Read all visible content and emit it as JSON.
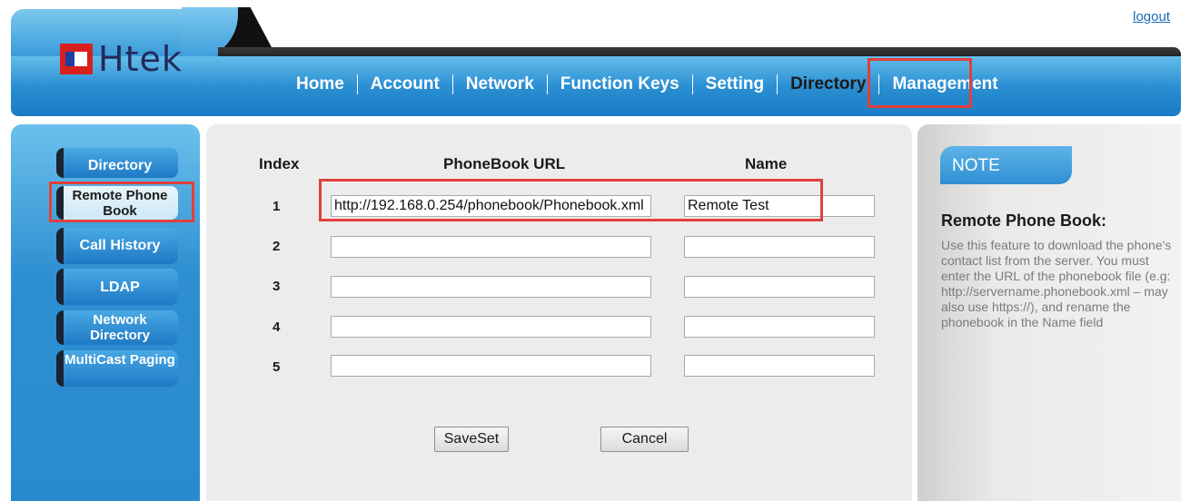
{
  "brand": {
    "logo_text": "Htek"
  },
  "header": {
    "logout_label": "logout"
  },
  "nav": {
    "items": [
      {
        "label": "Home"
      },
      {
        "label": "Account"
      },
      {
        "label": "Network"
      },
      {
        "label": "Function Keys"
      },
      {
        "label": "Setting"
      },
      {
        "label": "Directory",
        "active": true
      },
      {
        "label": "Management"
      }
    ]
  },
  "sidebar": {
    "items": [
      {
        "label": "Directory"
      },
      {
        "label": "Remote Phone Book",
        "active": true
      },
      {
        "label": "Call History"
      },
      {
        "label": "LDAP"
      },
      {
        "label": "Network Directory"
      },
      {
        "label": "MultiCast Paging"
      }
    ]
  },
  "table": {
    "headers": {
      "index": "Index",
      "url": "PhoneBook URL",
      "name": "Name"
    },
    "rows": [
      {
        "index": "1",
        "url": "http://192.168.0.254/phonebook/Phonebook.xml",
        "name": "Remote Test"
      },
      {
        "index": "2",
        "url": "",
        "name": ""
      },
      {
        "index": "3",
        "url": "",
        "name": ""
      },
      {
        "index": "4",
        "url": "",
        "name": ""
      },
      {
        "index": "5",
        "url": "",
        "name": ""
      }
    ]
  },
  "buttons": {
    "save": "SaveSet",
    "cancel": "Cancel"
  },
  "note": {
    "tab_label": "NOTE",
    "title": "Remote Phone Book:",
    "body": "Use this feature to download the phone's contact list from the server. You must enter the URL of the phonebook file (e.g: http://servername.phonebook.xml – may also use https://), and rename the phonebook in the Name field"
  },
  "colors": {
    "highlight": "#e2403a",
    "brand_blue": "#2b8fd3",
    "note_text": "#7b7b7b"
  }
}
